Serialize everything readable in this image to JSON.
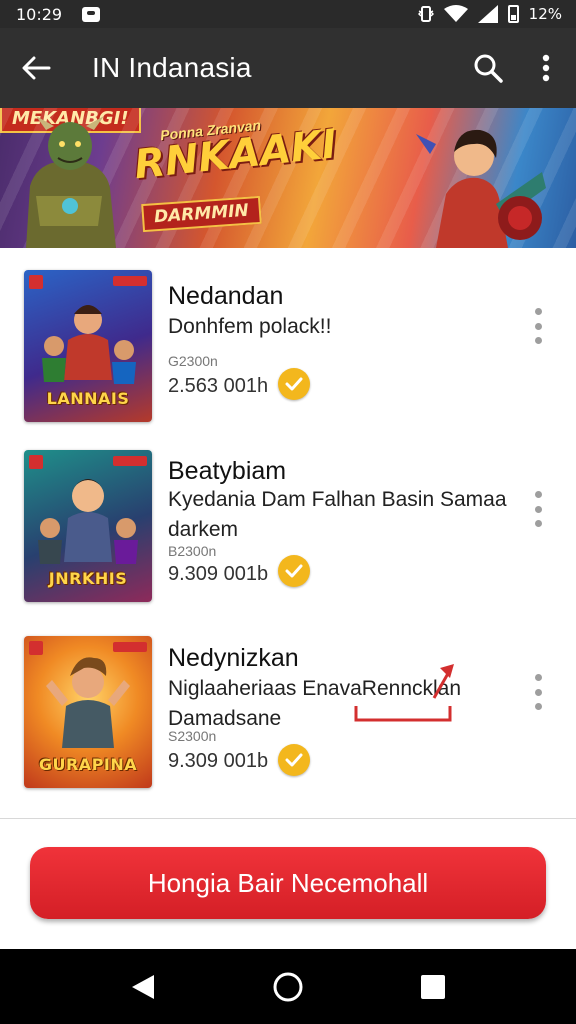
{
  "status_bar": {
    "time": "10:29",
    "battery": "12%"
  },
  "app_bar": {
    "title": "IN Indanasia"
  },
  "banner": {
    "kicker": "Ponna Zranvan",
    "heading": "RNKAAKI",
    "tag_left": "DARMMIN",
    "tag_right": "MEKANBGI!"
  },
  "items": [
    {
      "thumb_text": "LANNAIS",
      "name": "Nedandan",
      "description": "Donhfem polack!!",
      "size": "G2300n",
      "downloads": "2.563 001h"
    },
    {
      "thumb_text": "JNRKHIS",
      "name": "Beatybiam",
      "description": "Kyedania Dam Falhan Basin Samaa darkem",
      "size": "B2300n",
      "downloads": "9.309 001b"
    },
    {
      "thumb_text": "GURAPINA",
      "name": "Nedynizkan",
      "description": "Niglaaheriaas EnavaRenncklan Damadsane",
      "size": "S2300n",
      "downloads": "9.309 001b"
    }
  ],
  "cta": {
    "label": "Hongia Bair Necemohall"
  },
  "colors": {
    "accent": "#e3262d",
    "check": "#f3b71d",
    "app_bar": "#303030"
  }
}
